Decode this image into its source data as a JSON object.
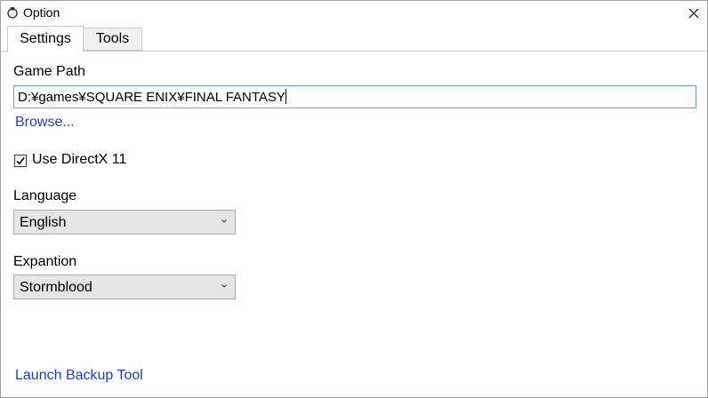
{
  "window": {
    "title": "Option",
    "close_glyph": "✕"
  },
  "tabs": [
    {
      "label": "Settings",
      "selected": true
    },
    {
      "label": "Tools",
      "selected": false
    }
  ],
  "settings": {
    "game_path_label": "Game Path",
    "game_path_value": "D:¥games¥SQUARE ENIX¥FINAL FANTASY",
    "browse_link": "Browse...",
    "directx_checkbox_label": "Use DirectX 11",
    "directx_checked": true,
    "language_label": "Language",
    "language_value": "English",
    "expansion_label": "Expantion",
    "expansion_value": "Stormblood",
    "backup_link": "Launch Backup Tool"
  },
  "colors": {
    "link": "#1f3fbf",
    "input_focus_border": "#6a9fd4",
    "select_bg": "#e5e5e5"
  }
}
